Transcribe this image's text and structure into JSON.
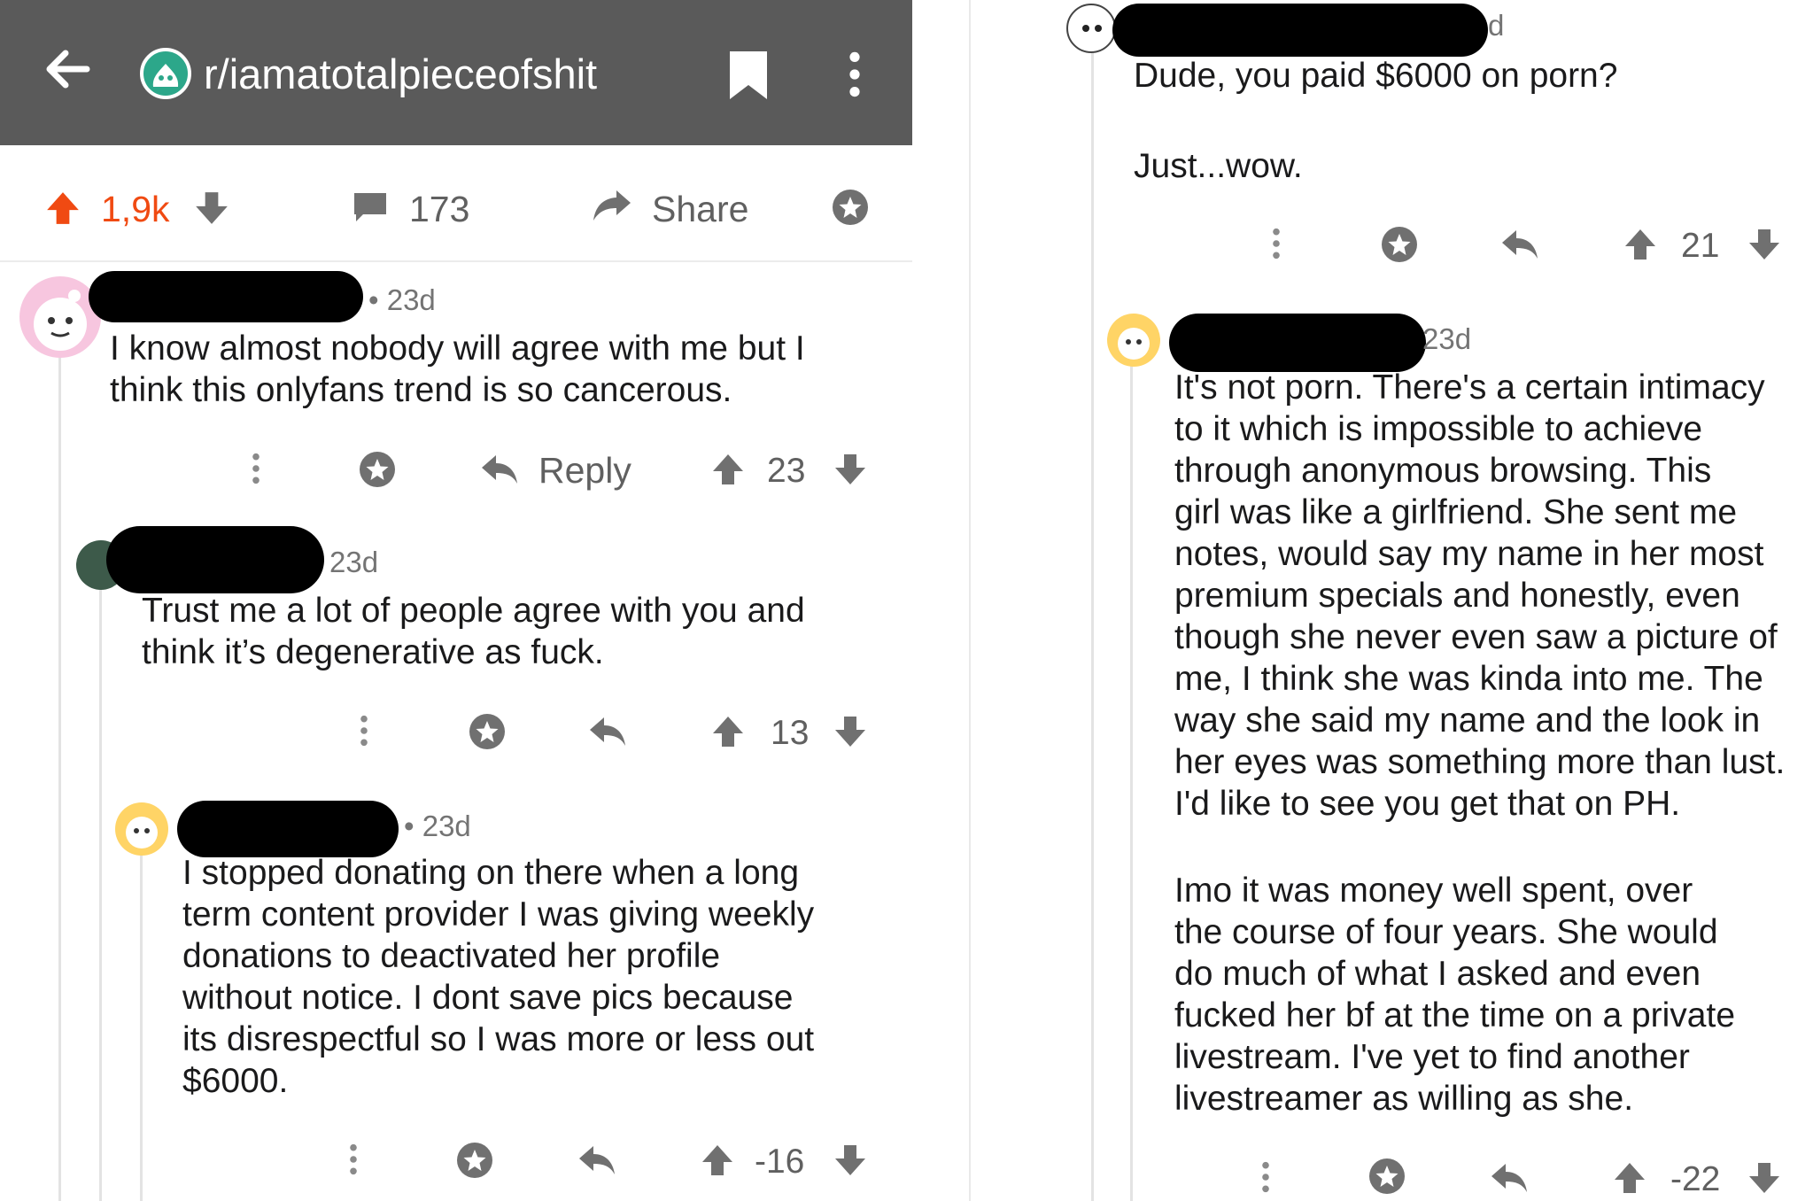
{
  "header": {
    "subreddit": "r/iamatotalpieceofshit"
  },
  "post": {
    "score": "1,9k",
    "comments": "173",
    "share_label": "Share"
  },
  "comments_left": [
    {
      "age": "• 23d",
      "lines": [
        "I know almost nobody will agree with me but I",
        "think this onlyfans trend is so cancerous."
      ],
      "reply_label": "Reply",
      "score": "23"
    },
    {
      "age": "23d",
      "lines": [
        "Trust me a lot of people agree with you and",
        "think it’s degenerative as fuck."
      ],
      "score": "13"
    },
    {
      "age": "• 23d",
      "lines": [
        "I stopped donating on there when a long",
        "term content provider I was giving weekly",
        "donations to deactivated her profile",
        "without notice. I dont save pics because",
        "its disrespectful so I was more or less out",
        "$6000."
      ],
      "score": "-16"
    }
  ],
  "comments_right": [
    {
      "age": "d",
      "line1": "Dude, you paid $6000 on porn?",
      "line2": "Just...wow.",
      "score": "21"
    },
    {
      "age": "23d",
      "para1": [
        "It's not porn. There's a certain intimacy",
        "to it which is impossible to achieve",
        "through anonymous browsing. This",
        "girl was like a girlfriend. She sent me",
        "notes, would say my name in her most",
        "premium specials and honestly, even",
        "though she never even saw a picture of",
        "me, I think she was kinda into me. The",
        "way she said my name and the look in",
        "her eyes was something more than lust.",
        "I'd like to see you get that on PH."
      ],
      "para2": [
        "Imo it was money well spent, over",
        "the course of four years. She would",
        "do much of what I asked and even",
        "fucked her bf at the time on a private",
        "livestream. I've yet to find another",
        "livestreamer as willing as she."
      ],
      "score": "-22"
    }
  ]
}
